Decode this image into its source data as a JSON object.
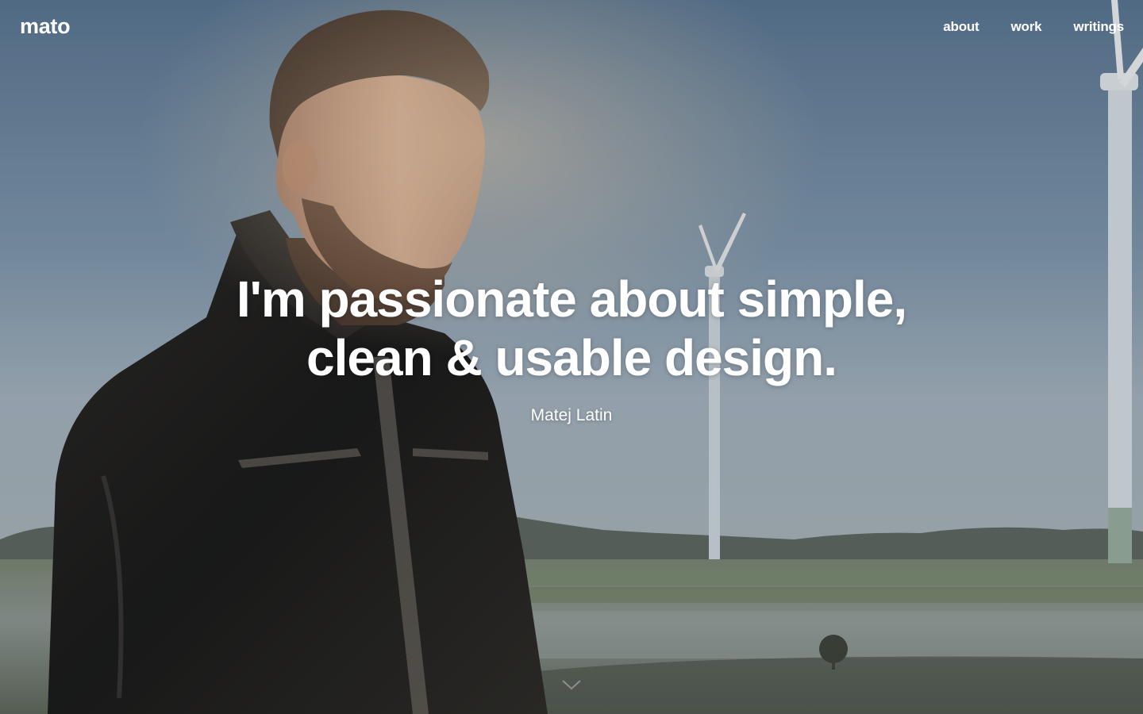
{
  "site": {
    "logo": "mato"
  },
  "nav": {
    "items": [
      {
        "label": "about"
      },
      {
        "label": "work"
      },
      {
        "label": "writings"
      }
    ]
  },
  "hero": {
    "headline_line1": "I'm passionate about simple,",
    "headline_line2": "clean & usable design.",
    "author": "Matej Latin",
    "scroll_icon": "chevron-down-icon"
  },
  "colors": {
    "text": "#ffffff",
    "sky": "#7e95aa",
    "jacket": "#1c1a19"
  }
}
